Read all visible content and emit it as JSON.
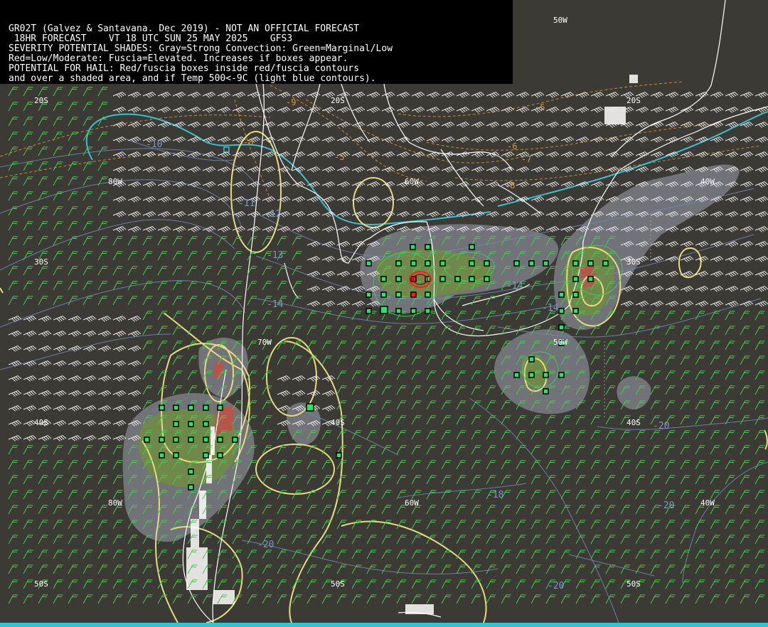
{
  "header": {
    "lines": [
      "GR02T (Galvez & Santavana. Dec 2019) - NOT AN OFFICIAL FORECAST",
      " 18HR FORECAST    VT 18 UTC SUN 25 MAY 2025    GFS3",
      "SEVERITY POTENTIAL SHADES: Gray=Strong Convection: Green=Marginal/Low",
      "Red=Low/Moderate: Fuscia=Elevated. Increases if boxes appear.",
      "POTENTIAL FOR HAIL: Red/fuscia boxes inside red/fuscia contours",
      "and over a shaded area, and if Temp 500<-9C (light blue contours)."
    ]
  },
  "grid_labels": {
    "lon_50w_top": "50W",
    "lat_20s_a": "20S",
    "lat_20s_b": "20S",
    "lat_20s_c": "20S",
    "lon_80w_a": "80W",
    "lon_60w_a": "60W",
    "lon_40w_a": "40W",
    "lat_30s_a": "30S",
    "lat_30s_b": "30S",
    "lon_70w": "70W",
    "lon_50w_mid": "50W",
    "lat_40s_a": "40S",
    "lat_40s_b": "40S",
    "lat_40s_c": "40S",
    "lon_80w_b": "80W",
    "lon_60w_b": "60W",
    "lon_40w_b": "40W",
    "lat_50s_a": "50S",
    "lat_50s_b": "50S",
    "lat_50s_c": "50S"
  },
  "temp_labels": {
    "m10": "-10",
    "m11": "-11",
    "m12": "-12",
    "m13": "-13",
    "m14a": "-14",
    "m14b": "-14",
    "m14c": "-14",
    "m18": "-18",
    "m20a": "-20",
    "m20b": "-20",
    "m20c": "-20",
    "m20d": "-20"
  },
  "dewpoint_labels": {
    "m5a": "-5",
    "m5b": "-5",
    "m6": "-6",
    "m7": "-7",
    "m8a": "-8",
    "m8b": "-8",
    "m9": "-9"
  },
  "colors": {
    "background": "#3c3a34",
    "coast": "#ffffff",
    "yellow_contour": "#e8dc7a",
    "blue_contour": "#6d86b8",
    "cyan_contour": "#35c2d4",
    "orange_dashed": "#c98a2e",
    "gray_shade": "#7b7d86",
    "green_shade": "#6f8f3e",
    "red_shade": "#c0504a",
    "box_green": "#2ee06a",
    "box_red": "#ff1a1a"
  }
}
